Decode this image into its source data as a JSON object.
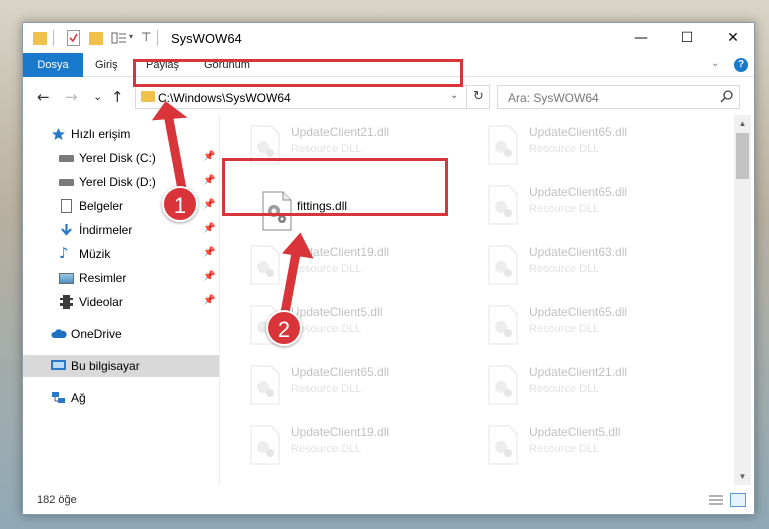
{
  "window": {
    "title": "SysWOW64",
    "minimize_glyph": "—",
    "maximize_glyph": "☐",
    "close_glyph": "✕"
  },
  "ribbon": {
    "tabs": [
      "Dosya",
      "Giriş",
      "Paylaş",
      "Görünüm"
    ],
    "help": "?"
  },
  "nav": {
    "back": "←",
    "forward": "→",
    "recent": "⌄",
    "up": "↑"
  },
  "address": {
    "path": "C:\\Windows\\SysWOW64",
    "refresh": "↻"
  },
  "search": {
    "placeholder": "Ara: SysWOW64",
    "icon": "⌕"
  },
  "sidebar": {
    "items": [
      {
        "label": "Hızlı erişim",
        "icon": "star-icon"
      },
      {
        "label": "Yerel Disk (C:)",
        "icon": "drive-icon",
        "pinned": true
      },
      {
        "label": "Yerel Disk (D:)",
        "icon": "drive-icon",
        "pinned": true
      },
      {
        "label": "Belgeler",
        "icon": "documents-icon",
        "pinned": true
      },
      {
        "label": "İndirmeler",
        "icon": "downloads-icon",
        "pinned": true
      },
      {
        "label": "Müzik",
        "icon": "music-icon",
        "pinned": true
      },
      {
        "label": "Resimler",
        "icon": "pictures-icon",
        "pinned": true
      },
      {
        "label": "Videolar",
        "icon": "videos-icon",
        "pinned": true
      },
      {
        "label": "OneDrive",
        "icon": "cloud-icon"
      },
      {
        "label": "Bu bilgisayar",
        "icon": "computer-icon",
        "selected": true
      },
      {
        "label": "Ağ",
        "icon": "network-icon"
      }
    ]
  },
  "files": {
    "left": [
      {
        "name": "UpdateClient21.dll",
        "type": "Resource DLL"
      },
      {
        "name": "fittings.dll",
        "type": ""
      },
      {
        "name": "UpdateClient19.dll",
        "type": "Resource DLL"
      },
      {
        "name": "UpdateClient5.dll",
        "type": "Resource DLL"
      },
      {
        "name": "UpdateClient65.dll",
        "type": "Resource DLL"
      },
      {
        "name": "UpdateClient19.dll",
        "type": "Resource DLL"
      }
    ],
    "right": [
      {
        "name": "UpdateClient65.dll",
        "type": "Resource DLL"
      },
      {
        "name": "UpdateClient65.dll",
        "type": "Resource DLL"
      },
      {
        "name": "UpdateClient63.dll",
        "type": "Resource DLL"
      },
      {
        "name": "UpdateClient65.dll",
        "type": "Resource DLL"
      },
      {
        "name": "UpdateClient21.dll",
        "type": "Resource DLL"
      },
      {
        "name": "UpdateClient5.dll",
        "type": "Resource DLL"
      }
    ]
  },
  "status": {
    "count": "182 öğe"
  },
  "annotations": {
    "step1": "1",
    "step2": "2",
    "highlight_color": "#d9343a"
  }
}
